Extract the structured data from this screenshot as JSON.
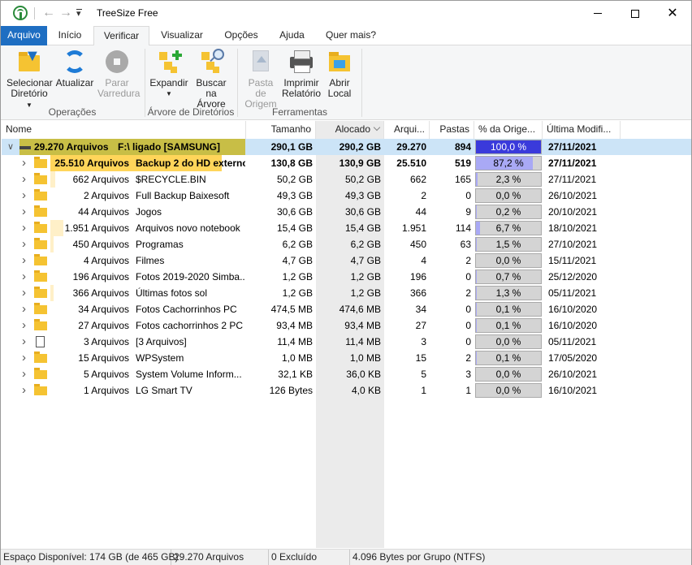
{
  "window": {
    "title": "TreeSize Free"
  },
  "tabs": [
    "Arquivo",
    "Início",
    "Verificar",
    "Visualizar",
    "Opções",
    "Ajuda",
    "Quer mais?"
  ],
  "ribbon": {
    "select_dir": [
      "Selecionar",
      "Diretório"
    ],
    "refresh": "Atualizar",
    "stop": [
      "Parar",
      "Varredura"
    ],
    "group_ops": "Operações",
    "expand": "Expandir",
    "search_tree": [
      "Buscar na",
      "Árvore"
    ],
    "group_tree": "Árvore de Diretórios",
    "parent_folder": [
      "Pasta de",
      "Origem"
    ],
    "print_report": [
      "Imprimir",
      "Relatório"
    ],
    "open_local": [
      "Abrir",
      "Local"
    ],
    "group_tools": "Ferramentas"
  },
  "columns": {
    "name": "Nome",
    "size": "Tamanho",
    "allocated": "Alocado",
    "files": "Arqui...",
    "folders": "Pastas",
    "pct": "% da Orige...",
    "modified": "Última Modifi..."
  },
  "rows": [
    {
      "files_label": "29.270 Arquivos",
      "name": "F:\\  ligado  [SAMSUNG]",
      "size": "290,1 GB",
      "alloc": "290,2 GB",
      "files": "29.270",
      "folders": "894",
      "pct": "100,0 %",
      "pct_value": 100,
      "modified": "27/11/2021",
      "level": 0,
      "type": "drive",
      "expanded": true
    },
    {
      "files_label": "25.510 Arquivos",
      "name": "Backup 2 do HD externo",
      "size": "130,8 GB",
      "alloc": "130,9 GB",
      "files": "25.510",
      "folders": "519",
      "pct": "87,2 %",
      "pct_value": 87.2,
      "modified": "27/11/2021",
      "level": 1,
      "type": "folder"
    },
    {
      "files_label": "662 Arquivos",
      "name": "$RECYCLE.BIN",
      "size": "50,2 GB",
      "alloc": "50,2 GB",
      "files": "662",
      "folders": "165",
      "pct": "2,3 %",
      "pct_value": 2.3,
      "modified": "27/11/2021",
      "level": 1,
      "type": "folder"
    },
    {
      "files_label": "2 Arquivos",
      "name": "Full Backup Baixesoft",
      "size": "49,3 GB",
      "alloc": "49,3 GB",
      "files": "2",
      "folders": "0",
      "pct": "0,0 %",
      "pct_value": 0,
      "modified": "26/10/2021",
      "level": 1,
      "type": "folder"
    },
    {
      "files_label": "44 Arquivos",
      "name": "Jogos",
      "size": "30,6 GB",
      "alloc": "30,6 GB",
      "files": "44",
      "folders": "9",
      "pct": "0,2 %",
      "pct_value": 0.2,
      "modified": "20/10/2021",
      "level": 1,
      "type": "folder"
    },
    {
      "files_label": "1.951 Arquivos",
      "name": "Arquivos novo notebook",
      "size": "15,4 GB",
      "alloc": "15,4 GB",
      "files": "1.951",
      "folders": "114",
      "pct": "6,7 %",
      "pct_value": 6.7,
      "modified": "18/10/2021",
      "level": 1,
      "type": "folder"
    },
    {
      "files_label": "450 Arquivos",
      "name": "Programas",
      "size": "6,2 GB",
      "alloc": "6,2 GB",
      "files": "450",
      "folders": "63",
      "pct": "1,5 %",
      "pct_value": 1.5,
      "modified": "27/10/2021",
      "level": 1,
      "type": "folder"
    },
    {
      "files_label": "4 Arquivos",
      "name": "Filmes",
      "size": "4,7 GB",
      "alloc": "4,7 GB",
      "files": "4",
      "folders": "2",
      "pct": "0,0 %",
      "pct_value": 0,
      "modified": "15/11/2021",
      "level": 1,
      "type": "folder"
    },
    {
      "files_label": "196 Arquivos",
      "name": "Fotos 2019-2020 Simba...",
      "size": "1,2 GB",
      "alloc": "1,2 GB",
      "files": "196",
      "folders": "0",
      "pct": "0,7 %",
      "pct_value": 0.7,
      "modified": "25/12/2020",
      "level": 1,
      "type": "folder"
    },
    {
      "files_label": "366 Arquivos",
      "name": "Últimas fotos sol",
      "size": "1,2 GB",
      "alloc": "1,2 GB",
      "files": "366",
      "folders": "2",
      "pct": "1,3 %",
      "pct_value": 1.3,
      "modified": "05/11/2021",
      "level": 1,
      "type": "folder"
    },
    {
      "files_label": "34 Arquivos",
      "name": "Fotos Cachorrinhos PC",
      "size": "474,5 MB",
      "alloc": "474,6 MB",
      "files": "34",
      "folders": "0",
      "pct": "0,1 %",
      "pct_value": 0.1,
      "modified": "16/10/2020",
      "level": 1,
      "type": "folder"
    },
    {
      "files_label": "27 Arquivos",
      "name": "Fotos cachorrinhos 2 PC",
      "size": "93,4 MB",
      "alloc": "93,4 MB",
      "files": "27",
      "folders": "0",
      "pct": "0,1 %",
      "pct_value": 0.1,
      "modified": "16/10/2020",
      "level": 1,
      "type": "folder"
    },
    {
      "files_label": "3 Arquivos",
      "name": "[3 Arquivos]",
      "size": "11,4 MB",
      "alloc": "11,4 MB",
      "files": "3",
      "folders": "0",
      "pct": "0,0 %",
      "pct_value": 0,
      "modified": "05/11/2021",
      "level": 1,
      "type": "file"
    },
    {
      "files_label": "15 Arquivos",
      "name": "WPSystem",
      "size": "1,0 MB",
      "alloc": "1,0 MB",
      "files": "15",
      "folders": "2",
      "pct": "0,1 %",
      "pct_value": 0.1,
      "modified": "17/05/2020",
      "level": 1,
      "type": "folder"
    },
    {
      "files_label": "5 Arquivos",
      "name": "System Volume Inform...",
      "size": "32,1 KB",
      "alloc": "36,0 KB",
      "files": "5",
      "folders": "3",
      "pct": "0,0 %",
      "pct_value": 0,
      "modified": "26/10/2021",
      "level": 1,
      "type": "folder"
    },
    {
      "files_label": "1 Arquivos",
      "name": "LG Smart TV",
      "size": "126 Bytes",
      "alloc": "4,0 KB",
      "files": "1",
      "folders": "1",
      "pct": "0,0 %",
      "pct_value": 0,
      "modified": "16/10/2021",
      "level": 1,
      "type": "folder"
    }
  ],
  "status": {
    "free_space": "Espaço Disponível: 174 GB  (de 465 GB)",
    "files": "29.270 Arquivos",
    "excluded": "0 Excluído",
    "cluster": "4.096 Bytes por Grupo (NTFS)"
  },
  "colors": {
    "accent": "#1e6ec2",
    "selection": "#cce4f7",
    "drive_bar": "#c8be46",
    "folder_bar": "#ffd55a",
    "pct_fill": "#a9a9f5",
    "pct_full": "#3a3adb"
  }
}
